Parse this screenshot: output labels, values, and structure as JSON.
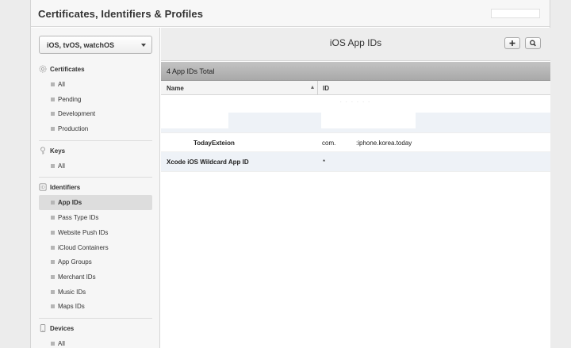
{
  "app": {
    "title": "Certificates, Identifiers & Profiles"
  },
  "platform_select": {
    "selected": "iOS, tvOS, watchOS"
  },
  "sidebar": {
    "certificates": {
      "label": "Certificates",
      "icon": "certificate-icon",
      "items": [
        "All",
        "Pending",
        "Development",
        "Production"
      ]
    },
    "keys": {
      "label": "Keys",
      "icon": "key-icon",
      "items": [
        "All"
      ]
    },
    "identifiers": {
      "label": "Identifiers",
      "icon": "identifier-icon",
      "items": [
        "App IDs",
        "Pass Type IDs",
        "Website Push IDs",
        "iCloud Containers",
        "App Groups",
        "Merchant IDs",
        "Music IDs",
        "Maps IDs"
      ],
      "active": "App IDs"
    },
    "devices": {
      "label": "Devices",
      "icon": "device-icon",
      "items": [
        "All"
      ]
    }
  },
  "main": {
    "heading": "iOS App IDs",
    "total": "4 App IDs Total",
    "columns": {
      "name": "Name",
      "id": "ID"
    },
    "rows": [
      {
        "name": "",
        "id": ""
      },
      {
        "name": "TodayExteion",
        "id_prefix": "com.",
        "id_suffix": ":iphone.korea.today"
      },
      {
        "name": "Xcode iOS Wildcard App ID",
        "id": "*"
      }
    ]
  },
  "colors": {
    "selected_row_bg": "#dddddd",
    "alt_row_bg": "#eef2f7",
    "total_bar": "#b5b5b5"
  }
}
